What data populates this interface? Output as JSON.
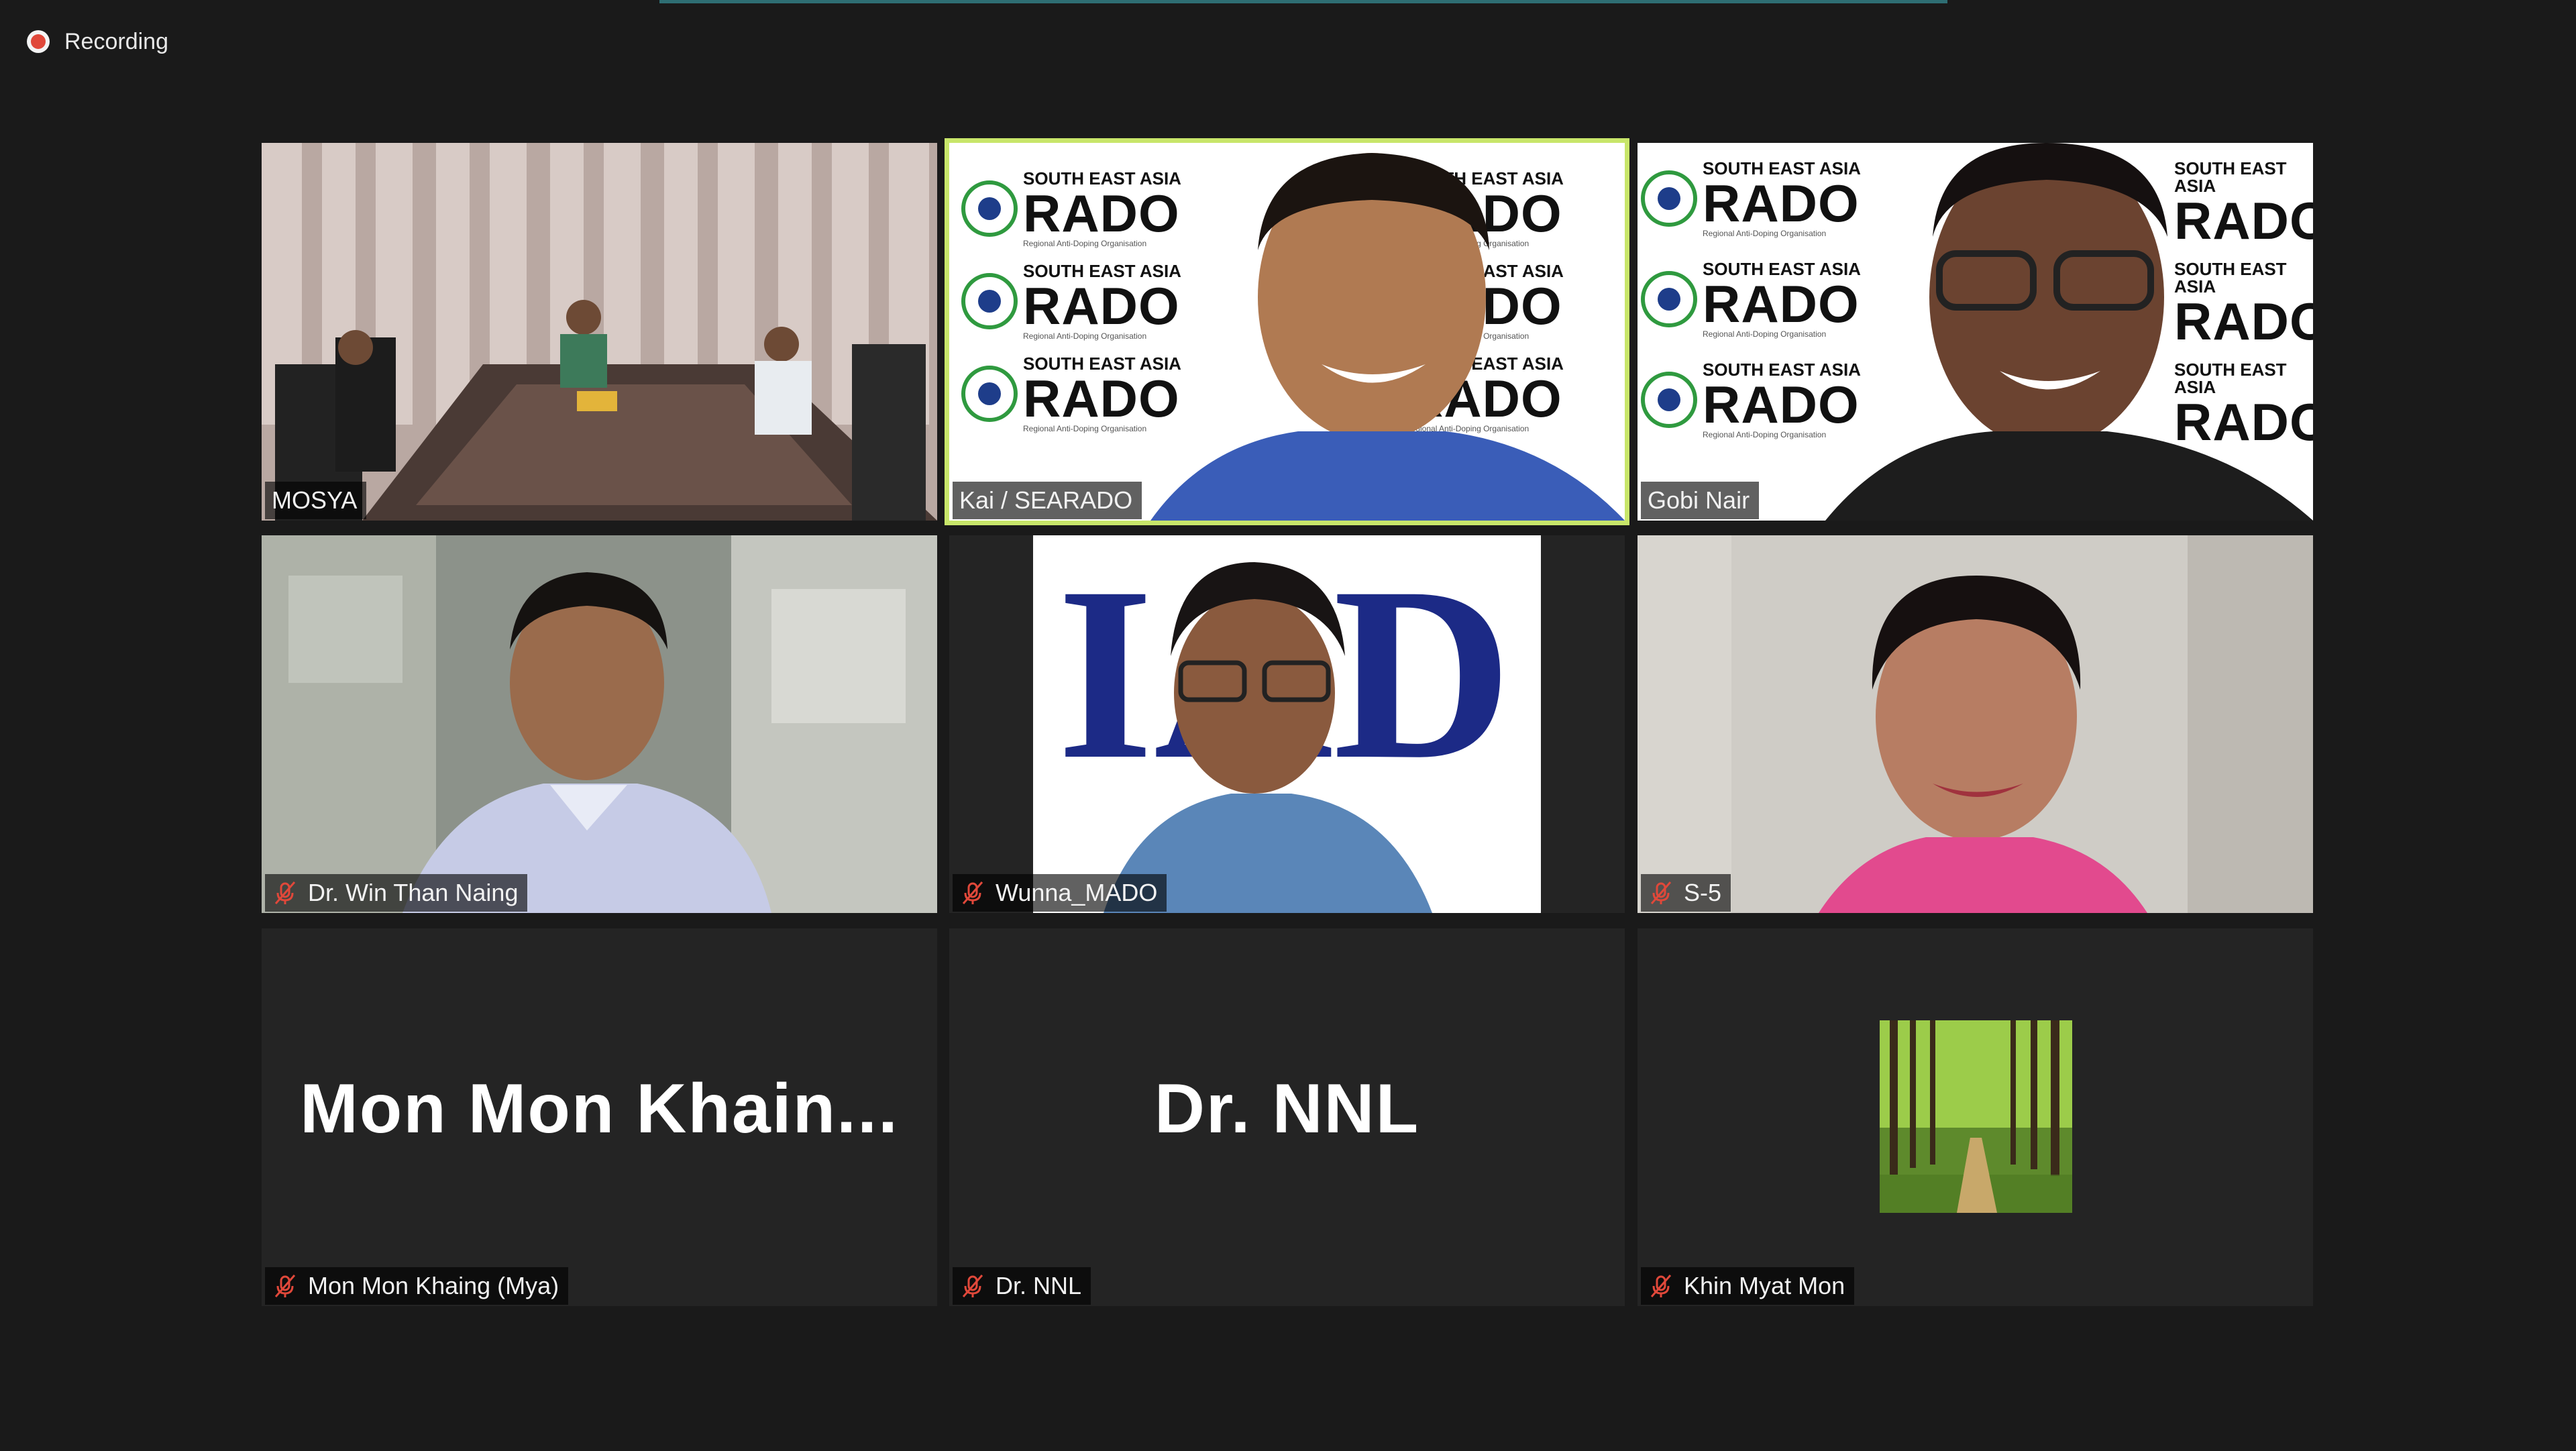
{
  "recording": {
    "label": "Recording"
  },
  "tiles": [
    {
      "name": "MOSYA",
      "muted": false,
      "active": false
    },
    {
      "name": "Kai / SEARADO",
      "muted": false,
      "active": true
    },
    {
      "name": "Gobi Nair",
      "muted": false,
      "active": false
    },
    {
      "name": "Dr. Win Than Naing",
      "muted": true,
      "active": false
    },
    {
      "name": "Wunna_MADO",
      "muted": true,
      "active": false
    },
    {
      "name": "S-5",
      "muted": true,
      "active": false
    },
    {
      "name": "Mon Mon Khaing (Mya)",
      "display": "Mon  Mon  Khain...",
      "muted": true,
      "active": false
    },
    {
      "name": "Dr. NNL",
      "display": "Dr. NNL",
      "muted": true,
      "active": false
    },
    {
      "name": "Khin Myat Mon",
      "muted": true,
      "active": false
    }
  ],
  "backdrop": {
    "region": "SOUTH EAST ASIA",
    "brand": "RADO",
    "tagline": "Regional Anti-Doping Organisation"
  },
  "mado_letters": "IAD",
  "colors": {
    "background": "#1a1a1a",
    "tile": "#242424",
    "active_speaker": "#c8e66a",
    "recording_dot": "#e0483a",
    "muted_icon": "#e0483a"
  },
  "icons": {
    "recording": "record-dot-icon",
    "muted": "mic-muted-icon"
  }
}
